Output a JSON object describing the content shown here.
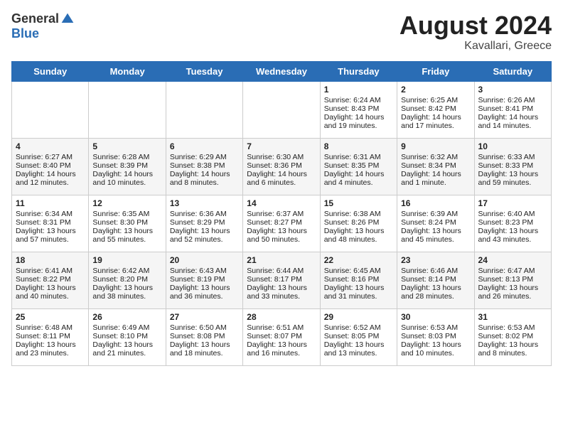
{
  "logo": {
    "general": "General",
    "blue": "Blue"
  },
  "title": {
    "month_year": "August 2024",
    "location": "Kavallari, Greece"
  },
  "days_of_week": [
    "Sunday",
    "Monday",
    "Tuesday",
    "Wednesday",
    "Thursday",
    "Friday",
    "Saturday"
  ],
  "weeks": [
    [
      {
        "day": "",
        "info": ""
      },
      {
        "day": "",
        "info": ""
      },
      {
        "day": "",
        "info": ""
      },
      {
        "day": "",
        "info": ""
      },
      {
        "day": "1",
        "info": "Sunrise: 6:24 AM\nSunset: 8:43 PM\nDaylight: 14 hours\nand 19 minutes."
      },
      {
        "day": "2",
        "info": "Sunrise: 6:25 AM\nSunset: 8:42 PM\nDaylight: 14 hours\nand 17 minutes."
      },
      {
        "day": "3",
        "info": "Sunrise: 6:26 AM\nSunset: 8:41 PM\nDaylight: 14 hours\nand 14 minutes."
      }
    ],
    [
      {
        "day": "4",
        "info": "Sunrise: 6:27 AM\nSunset: 8:40 PM\nDaylight: 14 hours\nand 12 minutes."
      },
      {
        "day": "5",
        "info": "Sunrise: 6:28 AM\nSunset: 8:39 PM\nDaylight: 14 hours\nand 10 minutes."
      },
      {
        "day": "6",
        "info": "Sunrise: 6:29 AM\nSunset: 8:38 PM\nDaylight: 14 hours\nand 8 minutes."
      },
      {
        "day": "7",
        "info": "Sunrise: 6:30 AM\nSunset: 8:36 PM\nDaylight: 14 hours\nand 6 minutes."
      },
      {
        "day": "8",
        "info": "Sunrise: 6:31 AM\nSunset: 8:35 PM\nDaylight: 14 hours\nand 4 minutes."
      },
      {
        "day": "9",
        "info": "Sunrise: 6:32 AM\nSunset: 8:34 PM\nDaylight: 14 hours\nand 1 minute."
      },
      {
        "day": "10",
        "info": "Sunrise: 6:33 AM\nSunset: 8:33 PM\nDaylight: 13 hours\nand 59 minutes."
      }
    ],
    [
      {
        "day": "11",
        "info": "Sunrise: 6:34 AM\nSunset: 8:31 PM\nDaylight: 13 hours\nand 57 minutes."
      },
      {
        "day": "12",
        "info": "Sunrise: 6:35 AM\nSunset: 8:30 PM\nDaylight: 13 hours\nand 55 minutes."
      },
      {
        "day": "13",
        "info": "Sunrise: 6:36 AM\nSunset: 8:29 PM\nDaylight: 13 hours\nand 52 minutes."
      },
      {
        "day": "14",
        "info": "Sunrise: 6:37 AM\nSunset: 8:27 PM\nDaylight: 13 hours\nand 50 minutes."
      },
      {
        "day": "15",
        "info": "Sunrise: 6:38 AM\nSunset: 8:26 PM\nDaylight: 13 hours\nand 48 minutes."
      },
      {
        "day": "16",
        "info": "Sunrise: 6:39 AM\nSunset: 8:24 PM\nDaylight: 13 hours\nand 45 minutes."
      },
      {
        "day": "17",
        "info": "Sunrise: 6:40 AM\nSunset: 8:23 PM\nDaylight: 13 hours\nand 43 minutes."
      }
    ],
    [
      {
        "day": "18",
        "info": "Sunrise: 6:41 AM\nSunset: 8:22 PM\nDaylight: 13 hours\nand 40 minutes."
      },
      {
        "day": "19",
        "info": "Sunrise: 6:42 AM\nSunset: 8:20 PM\nDaylight: 13 hours\nand 38 minutes."
      },
      {
        "day": "20",
        "info": "Sunrise: 6:43 AM\nSunset: 8:19 PM\nDaylight: 13 hours\nand 36 minutes."
      },
      {
        "day": "21",
        "info": "Sunrise: 6:44 AM\nSunset: 8:17 PM\nDaylight: 13 hours\nand 33 minutes."
      },
      {
        "day": "22",
        "info": "Sunrise: 6:45 AM\nSunset: 8:16 PM\nDaylight: 13 hours\nand 31 minutes."
      },
      {
        "day": "23",
        "info": "Sunrise: 6:46 AM\nSunset: 8:14 PM\nDaylight: 13 hours\nand 28 minutes."
      },
      {
        "day": "24",
        "info": "Sunrise: 6:47 AM\nSunset: 8:13 PM\nDaylight: 13 hours\nand 26 minutes."
      }
    ],
    [
      {
        "day": "25",
        "info": "Sunrise: 6:48 AM\nSunset: 8:11 PM\nDaylight: 13 hours\nand 23 minutes."
      },
      {
        "day": "26",
        "info": "Sunrise: 6:49 AM\nSunset: 8:10 PM\nDaylight: 13 hours\nand 21 minutes."
      },
      {
        "day": "27",
        "info": "Sunrise: 6:50 AM\nSunset: 8:08 PM\nDaylight: 13 hours\nand 18 minutes."
      },
      {
        "day": "28",
        "info": "Sunrise: 6:51 AM\nSunset: 8:07 PM\nDaylight: 13 hours\nand 16 minutes."
      },
      {
        "day": "29",
        "info": "Sunrise: 6:52 AM\nSunset: 8:05 PM\nDaylight: 13 hours\nand 13 minutes."
      },
      {
        "day": "30",
        "info": "Sunrise: 6:53 AM\nSunset: 8:03 PM\nDaylight: 13 hours\nand 10 minutes."
      },
      {
        "day": "31",
        "info": "Sunrise: 6:53 AM\nSunset: 8:02 PM\nDaylight: 13 hours\nand 8 minutes."
      }
    ]
  ]
}
